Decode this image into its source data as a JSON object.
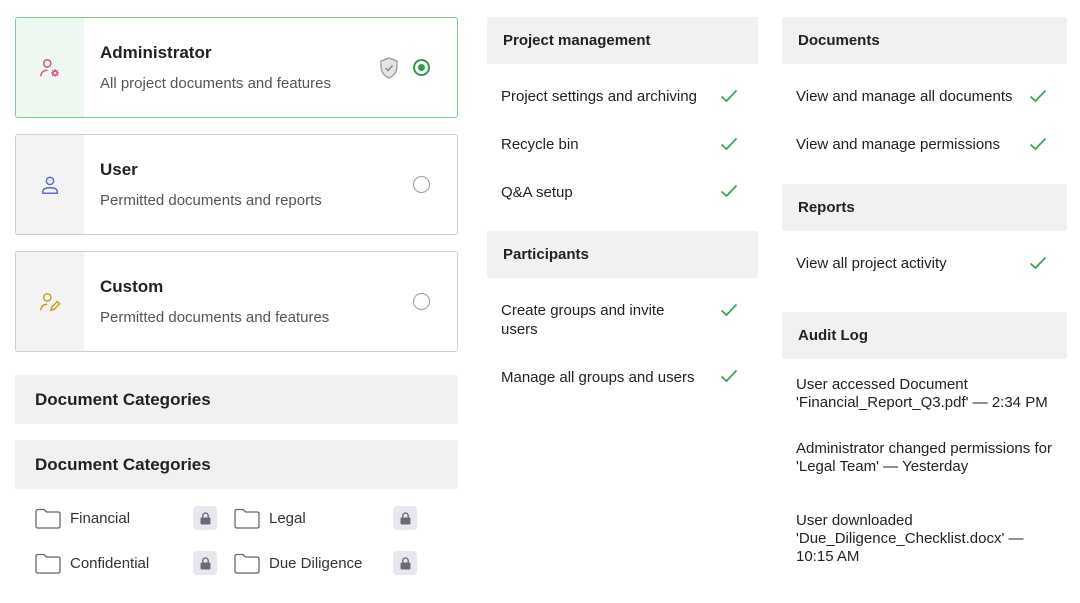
{
  "roles": [
    {
      "title": "Administrator",
      "description": "All project documents and features",
      "icon": "user-gear-icon",
      "selected": true
    },
    {
      "title": "User",
      "description": "Permitted documents and reports",
      "icon": "user-icon",
      "selected": false
    },
    {
      "title": "Custom",
      "description": "Permitted documents and features",
      "icon": "user-edit-icon",
      "selected": false
    }
  ],
  "categories": {
    "header_collapsed": "Document Categories",
    "header_expanded": "Document Categories",
    "folders": [
      {
        "label": "Financial",
        "locked": true
      },
      {
        "label": "Legal",
        "locked": true
      },
      {
        "label": "Confidential",
        "locked": true
      },
      {
        "label": "Due Diligence",
        "locked": true
      }
    ]
  },
  "project_management": {
    "title": "Project management",
    "items": [
      {
        "label": "Project settings and archiving",
        "granted": true
      },
      {
        "label": "Recycle bin",
        "granted": true
      },
      {
        "label": "Q&A setup",
        "granted": true
      }
    ]
  },
  "participants": {
    "title": "Participants",
    "items": [
      {
        "label": "Create groups and invite users",
        "granted": true
      },
      {
        "label": "Manage all groups and users",
        "granted": true
      }
    ]
  },
  "documents": {
    "title": "Documents",
    "items": [
      {
        "label": "View and manage all documents",
        "granted": true
      },
      {
        "label": "View and manage permissions",
        "granted": true
      }
    ]
  },
  "reports": {
    "title": "Reports",
    "items": [
      {
        "label": "View all project activity",
        "granted": true
      }
    ]
  },
  "audit_log": {
    "title": "Audit Log",
    "entries": [
      "User accessed Document 'Financial_Report_Q3.pdf' — 2:34 PM",
      "Administrator changed permissions for 'Legal Team' — Yesterday",
      "User downloaded 'Due_Diligence_Checklist.docx' — 10:15 AM"
    ]
  },
  "colors": {
    "accent_green": "#2c9e4a",
    "selected_border": "#7ccb8f",
    "admin_icon": "#d9508a",
    "user_icon": "#5b6ec9",
    "custom_icon": "#c9a11f"
  }
}
